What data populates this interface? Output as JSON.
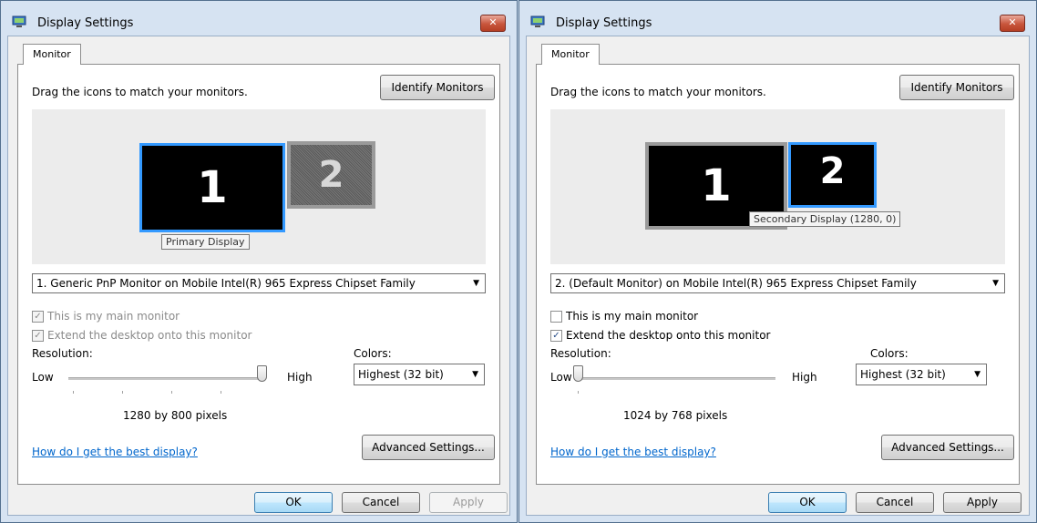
{
  "dialogs": [
    {
      "title": "Display Settings",
      "close_label": "✕",
      "tab_label": "Monitor",
      "drag_label": "Drag the icons to match your monitors.",
      "identify_label": "Identify Monitors",
      "monitor1_label": "1",
      "monitor2_label": "2",
      "tooltip": "Primary Display",
      "monitor_select": "1. Generic PnP Monitor on Mobile Intel(R) 965 Express Chipset Family",
      "main_monitor_label": "This is my main monitor",
      "main_monitor_checked": true,
      "extend_label": "Extend the desktop onto this monitor",
      "extend_checked": true,
      "checkboxes_disabled": true,
      "resolution_label": "Resolution:",
      "colors_label": "Colors:",
      "low_label": "Low",
      "high_label": "High",
      "resolution_slider_fraction": 1.0,
      "colors_value": "Highest (32 bit)",
      "pixels_text": "1280 by 800 pixels",
      "help_link": "How do I get the best display?",
      "advanced_label": "Advanced Settings...",
      "ok_label": "OK",
      "cancel_label": "Cancel",
      "apply_label": "Apply",
      "apply_disabled": true
    },
    {
      "title": "Display Settings",
      "close_label": "✕",
      "tab_label": "Monitor",
      "drag_label": "Drag the icons to match your monitors.",
      "identify_label": "Identify Monitors",
      "monitor1_label": "1",
      "monitor2_label": "2",
      "tooltip": "Secondary Display (1280, 0)",
      "monitor_select": "2. (Default Monitor) on Mobile Intel(R) 965 Express Chipset Family",
      "main_monitor_label": "This is my main monitor",
      "main_monitor_checked": false,
      "extend_label": "Extend the desktop onto this monitor",
      "extend_checked": true,
      "checkboxes_disabled": false,
      "resolution_label": "Resolution:",
      "colors_label": "Colors:",
      "low_label": "Low",
      "high_label": "High",
      "resolution_slider_fraction": 0.0,
      "colors_value": "Highest (32 bit)",
      "pixels_text": "1024 by 768 pixels",
      "help_link": "How do I get the best display?",
      "advanced_label": "Advanced Settings...",
      "ok_label": "OK",
      "cancel_label": "Cancel",
      "apply_label": "Apply",
      "apply_disabled": false
    }
  ],
  "colors": {
    "selection_border": "#3399ff",
    "link": "#0066cc",
    "close_button": "#c8553c"
  },
  "icons": {
    "title_icon": "display-settings-icon",
    "close_icon": "close-icon",
    "dropdown_icon": "chevron-down-icon",
    "check_icon": "checkmark-icon"
  }
}
